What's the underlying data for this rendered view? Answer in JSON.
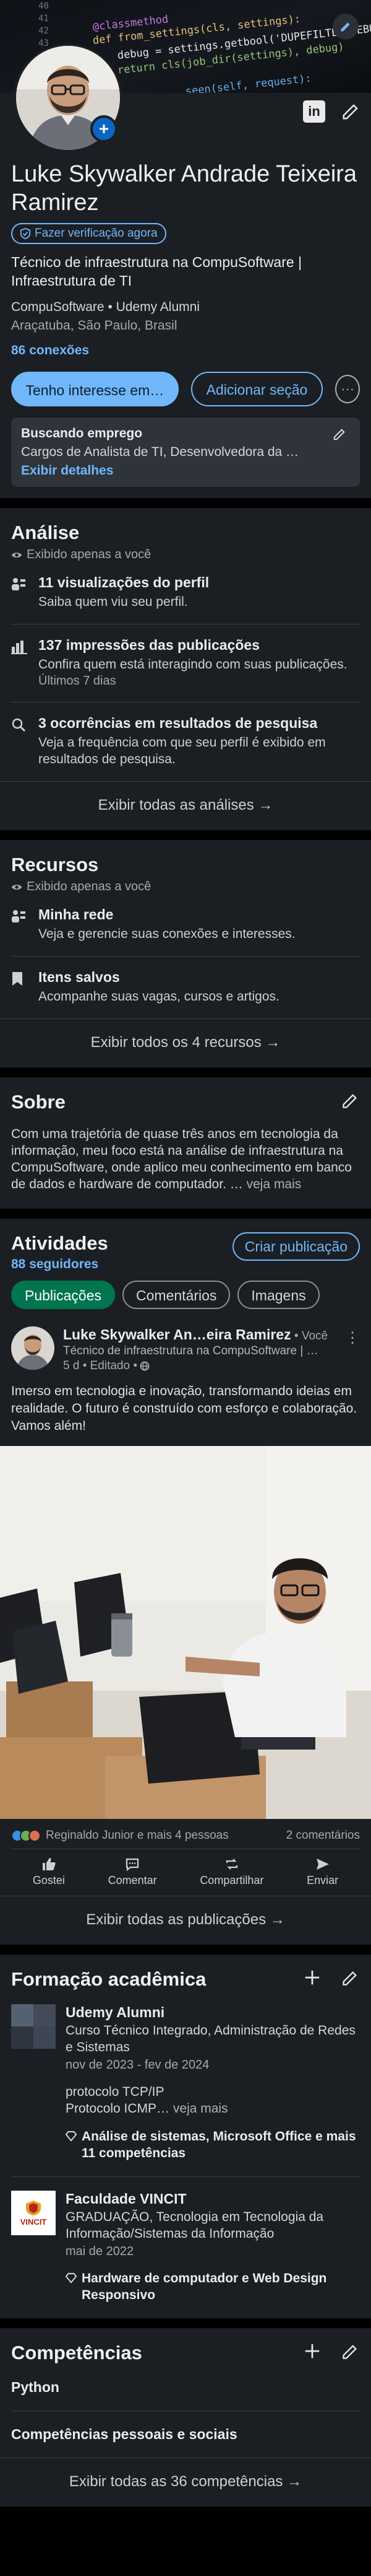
{
  "cover": {
    "line_numbers": [
      "40",
      "41",
      "42",
      "43"
    ],
    "code_lines": [
      "@classmethod",
      "def from_settings(cls, settings):",
      "debug = settings.getbool('DUPEFILTER_DEBUG')",
      "return cls(job_dir(settings), debug)",
      "seen(self, request):"
    ]
  },
  "profile": {
    "name": "Luke Skywalker Andrade Teixeira Ramirez",
    "verify_label": "Fazer verificação agora",
    "headline": "Técnico de infraestrutura na CompuSoftware | Infraestrutura de TI",
    "companies": "CompuSoftware  • Udemy Alumni",
    "location": "Araçatuba, São Paulo, Brasil",
    "connections": "86 conexões",
    "btn_primary": "Tenho interesse em…",
    "btn_secondary": "Adicionar seção",
    "btn_more": "···",
    "job": {
      "title": "Buscando emprego",
      "desc": "Cargos de Analista de TI, Desenvolvedora da …",
      "link": "Exibir detalhes"
    }
  },
  "analytics": {
    "title": "Análise",
    "private": "Exibido apenas a você",
    "items": [
      {
        "title": "11 visualizações do perfil",
        "sub": "Saiba quem viu seu perfil.",
        "small": ""
      },
      {
        "title": "137 impressões das publicações",
        "sub": "Confira quem está interagindo com suas publicações.",
        "small": "Últimos 7 dias"
      },
      {
        "title": "3 ocorrências em resultados de pesquisa",
        "sub": "Veja a frequência com que seu perfil é exibido em resultados de pesquisa.",
        "small": ""
      }
    ],
    "footer": "Exibir todas as análises →"
  },
  "resources": {
    "title": "Recursos",
    "private": "Exibido apenas a você",
    "items": [
      {
        "title": "Minha rede",
        "sub": "Veja e gerencie suas conexões e interesses."
      },
      {
        "title": "Itens salvos",
        "sub": "Acompanhe suas vagas, cursos e artigos."
      }
    ],
    "footer": "Exibir todos os 4 recursos →"
  },
  "about": {
    "title": "Sobre",
    "text": "Com uma trajetória de quase três anos em tecnologia da informação, meu foco está na análise de infraestrutura na CompuSoftware, onde aplico meu conhecimento em banco de dados e hardware de computador. …",
    "more": " veja mais"
  },
  "activity": {
    "title": "Atividades",
    "followers": "88 seguidores",
    "create_post": "Criar publicação",
    "tabs": [
      "Publicações",
      "Comentários",
      "Imagens"
    ],
    "post": {
      "author": "Luke Skywalker An…eira Ramirez",
      "you": " • Você",
      "headline": "Técnico de infraestrutura na CompuSoftware | …",
      "meta": "5 d • Editado •",
      "text": "Imerso em tecnologia e inovação, transformando ideias em realidade. O futuro é construído com esforço e colaboração. Vamos além!",
      "reactions": "Reginaldo Junior e mais 4 pessoas",
      "comments": "2 comentários",
      "actions": [
        "Gostei",
        "Comentar",
        "Compartilhar",
        "Enviar"
      ]
    },
    "footer": "Exibir todas as publicações →"
  },
  "education": {
    "title": "Formação acadêmica",
    "items": [
      {
        "school": "Udemy Alumni",
        "course": "Curso Técnico Integrado, Administração de Redes e Sistemas",
        "date": "nov de 2023 - fev de 2024",
        "desc_line1": "protocolo TCP/IP",
        "desc_line2": "Protocolo ICMP…",
        "more": " veja mais",
        "skills": "Análise de sistemas, Microsoft Office e mais 11 competências"
      },
      {
        "school": "Faculdade VINCIT",
        "logo_text": "VINCIT",
        "course": "GRADUAÇÃO, Tecnologia em Tecnologia da Informação/Sistemas da Informação",
        "date": "mai de 2022",
        "skills": "Hardware de computador e Web Design Responsivo"
      }
    ]
  },
  "skills": {
    "title": "Competências",
    "items": [
      "Python",
      "Competências pessoais e sociais"
    ],
    "footer": "Exibir todas as 36 competências →"
  },
  "colors": {
    "accent": "#71b7fb",
    "card": "#1b1f23",
    "green": "#01754f",
    "brand_blue": "#0a66c2"
  }
}
